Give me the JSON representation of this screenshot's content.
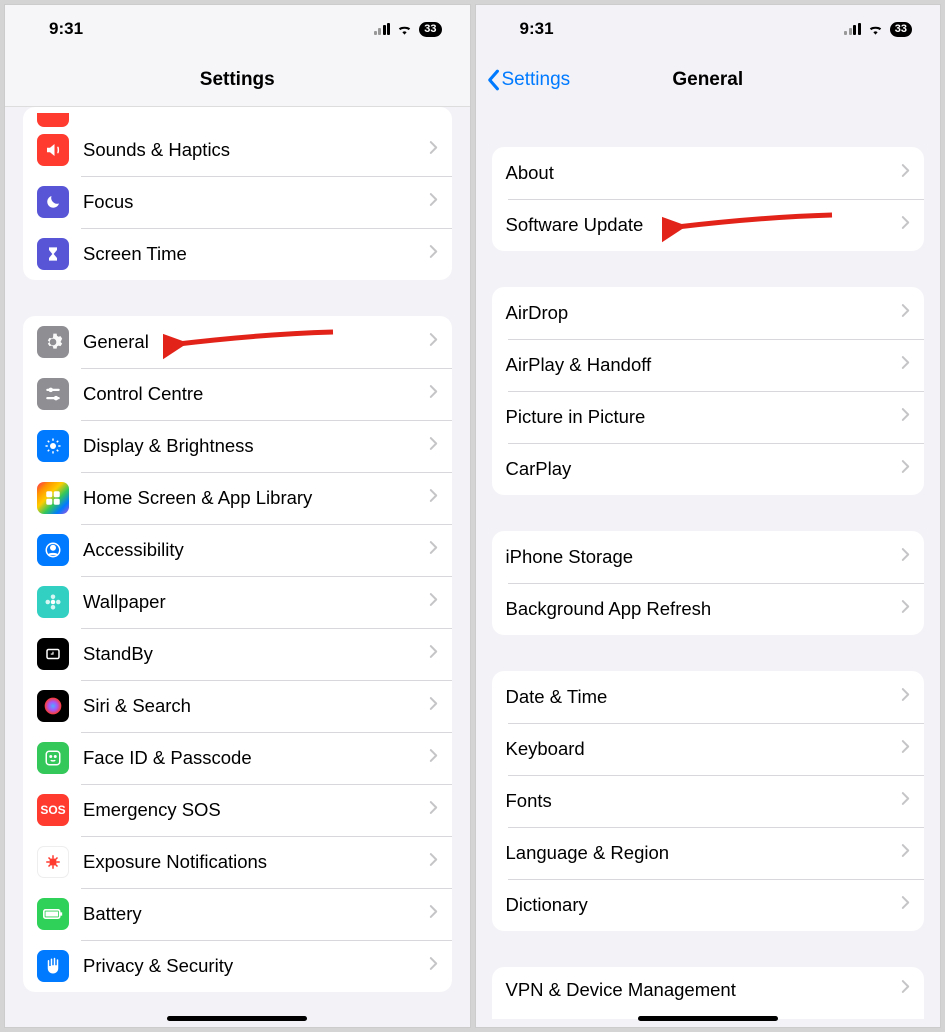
{
  "status": {
    "time": "9:31",
    "battery": "33"
  },
  "left": {
    "title": "Settings",
    "groups": [
      {
        "partialTop": true,
        "items": [
          {
            "name": "row-sounds",
            "label": "Sounds & Haptics",
            "icon": "volume-icon",
            "bg": "bg-red",
            "glyph": "volume"
          },
          {
            "name": "row-focus",
            "label": "Focus",
            "icon": "moon-icon",
            "bg": "bg-purple",
            "glyph": "moon"
          },
          {
            "name": "row-screentime",
            "label": "Screen Time",
            "icon": "hourglass-icon",
            "bg": "bg-darkhourglass",
            "glyph": "hourglass"
          }
        ]
      },
      {
        "items": [
          {
            "name": "row-general",
            "label": "General",
            "icon": "gear-icon",
            "bg": "bg-gray",
            "glyph": "gear",
            "arrow": true
          },
          {
            "name": "row-control-centre",
            "label": "Control Centre",
            "icon": "sliders-icon",
            "bg": "bg-gray",
            "glyph": "sliders"
          },
          {
            "name": "row-display",
            "label": "Display & Brightness",
            "icon": "sun-icon",
            "bg": "bg-blue",
            "glyph": "sun"
          },
          {
            "name": "row-homescreen",
            "label": "Home Screen & App Library",
            "icon": "apps-icon",
            "bg": "bg-multi",
            "glyph": "grid"
          },
          {
            "name": "row-accessibility",
            "label": "Accessibility",
            "icon": "person-icon",
            "bg": "bg-blue",
            "glyph": "person"
          },
          {
            "name": "row-wallpaper",
            "label": "Wallpaper",
            "icon": "flower-icon",
            "bg": "bg-teal",
            "glyph": "flower"
          },
          {
            "name": "row-standby",
            "label": "StandBy",
            "icon": "clock-icon",
            "bg": "bg-black",
            "glyph": "clock"
          },
          {
            "name": "row-siri",
            "label": "Siri & Search",
            "icon": "siri-icon",
            "bg": "bg-black",
            "glyph": "siri"
          },
          {
            "name": "row-faceid",
            "label": "Face ID & Passcode",
            "icon": "face-icon",
            "bg": "bg-green",
            "glyph": "face"
          },
          {
            "name": "row-sos",
            "label": "Emergency SOS",
            "icon": "sos-icon",
            "bg": "bg-red-sos",
            "glyph": "sos"
          },
          {
            "name": "row-exposure",
            "label": "Exposure Notifications",
            "icon": "virus-icon",
            "bg": "bg-white",
            "glyph": "virus"
          },
          {
            "name": "row-battery",
            "label": "Battery",
            "icon": "battery-icon",
            "bg": "bg-greensolid",
            "glyph": "battery"
          },
          {
            "name": "row-privacy",
            "label": "Privacy & Security",
            "icon": "hand-icon",
            "bg": "bg-blue",
            "glyph": "hand"
          }
        ]
      }
    ]
  },
  "right": {
    "back": "Settings",
    "title": "General",
    "groups": [
      {
        "items": [
          {
            "name": "row-about",
            "label": "About"
          },
          {
            "name": "row-software-update",
            "label": "Software Update",
            "arrow": true
          }
        ]
      },
      {
        "items": [
          {
            "name": "row-airdrop",
            "label": "AirDrop"
          },
          {
            "name": "row-airplay",
            "label": "AirPlay & Handoff"
          },
          {
            "name": "row-pip",
            "label": "Picture in Picture"
          },
          {
            "name": "row-carplay",
            "label": "CarPlay"
          }
        ]
      },
      {
        "items": [
          {
            "name": "row-storage",
            "label": "iPhone Storage"
          },
          {
            "name": "row-bgrefresh",
            "label": "Background App Refresh"
          }
        ]
      },
      {
        "items": [
          {
            "name": "row-datetime",
            "label": "Date & Time"
          },
          {
            "name": "row-keyboard",
            "label": "Keyboard"
          },
          {
            "name": "row-fonts",
            "label": "Fonts"
          },
          {
            "name": "row-language",
            "label": "Language & Region"
          },
          {
            "name": "row-dictionary",
            "label": "Dictionary"
          }
        ]
      },
      {
        "cutoff": true,
        "items": [
          {
            "name": "row-vpn",
            "label": "VPN & Device Management"
          }
        ]
      }
    ]
  }
}
